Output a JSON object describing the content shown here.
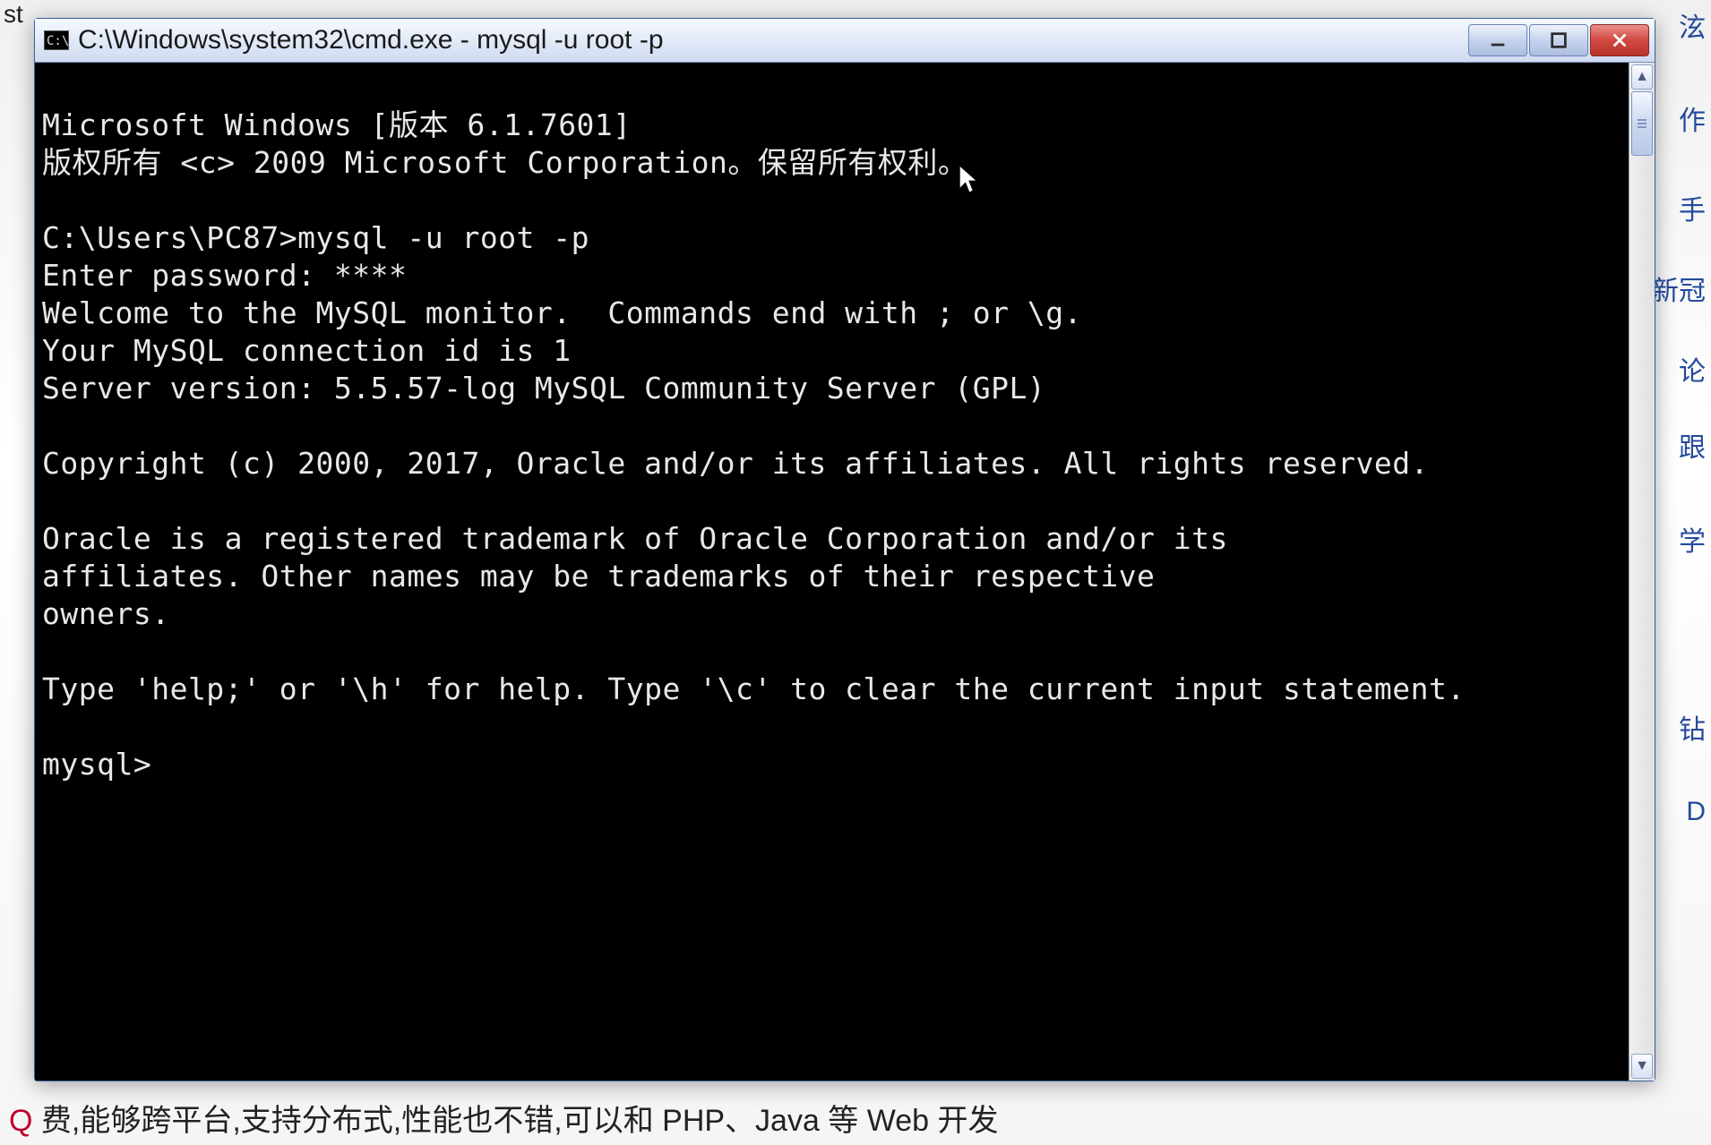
{
  "background": {
    "top_left_fragment": "st",
    "right_fragment_1": "泫",
    "right_fragment_2": "作",
    "right_fragment_3": "手",
    "right_fragment_4": "新冠",
    "right_fragment_5": "论",
    "right_fragment_6": "跟",
    "right_fragment_7": "学",
    "right_fragment_8": "钻",
    "right_fragment_9": "D",
    "bottom_q": "Q",
    "bottom_text": "费,能够跨平台,支持分布式,性能也不错,可以和 PHP、Java 等 Web 开发"
  },
  "window": {
    "icon_text": "C:\\",
    "title": "C:\\Windows\\system32\\cmd.exe - mysql  -u root -p"
  },
  "terminal": {
    "lines": [
      "Microsoft Windows [版本 6.1.7601]",
      "版权所有 <c> 2009 Microsoft Corporation。保留所有权利。",
      "",
      "C:\\Users\\PC87>mysql -u root -p",
      "Enter password: ****",
      "Welcome to the MySQL monitor.  Commands end with ; or \\g.",
      "Your MySQL connection id is 1",
      "Server version: 5.5.57-log MySQL Community Server (GPL)",
      "",
      "Copyright (c) 2000, 2017, Oracle and/or its affiliates. All rights reserved.",
      "",
      "Oracle is a registered trademark of Oracle Corporation and/or its",
      "affiliates. Other names may be trademarks of their respective",
      "owners.",
      "",
      "Type 'help;' or '\\h' for help. Type '\\c' to clear the current input statement.",
      "",
      "mysql>"
    ]
  }
}
